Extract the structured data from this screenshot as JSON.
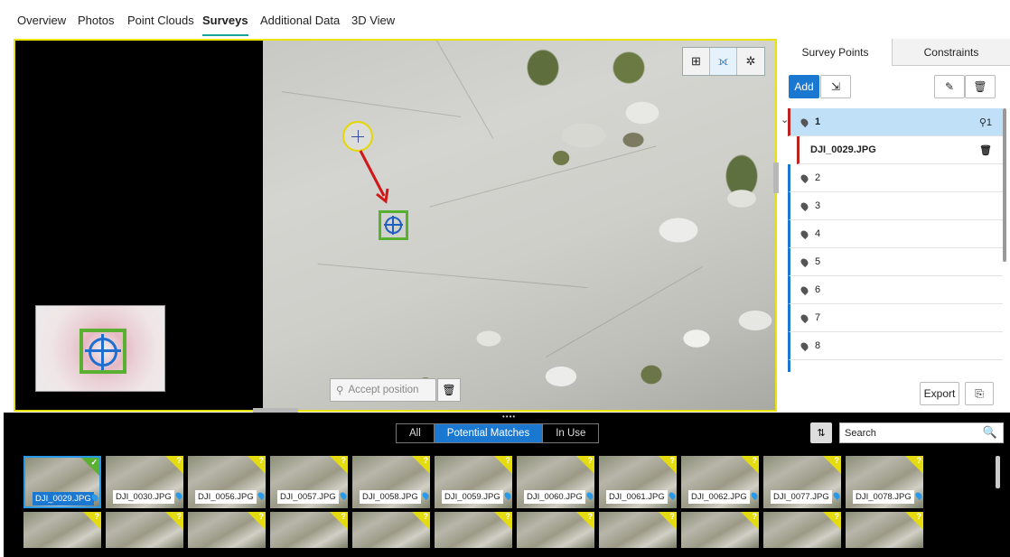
{
  "nav": {
    "tabs": [
      "Overview",
      "Photos",
      "Point Clouds",
      "Surveys",
      "Additional Data",
      "3D View"
    ],
    "active": "Surveys"
  },
  "viewer": {
    "accept_label": "Accept position",
    "tool_icons": [
      "fit-view-icon",
      "measure-icon",
      "settings-icon"
    ]
  },
  "panel": {
    "tabs": [
      "Survey Points",
      "Constraints"
    ],
    "add_label": "Add",
    "export_label": "Export",
    "selected_point": "1",
    "selected_point_count": "1",
    "selected_image": "DJI_0029.JPG",
    "points": [
      "2",
      "3",
      "4",
      "5",
      "6",
      "7",
      "8"
    ]
  },
  "bottom": {
    "filters": [
      "All",
      "Potential Matches",
      "In Use"
    ],
    "active_filter": "Potential Matches",
    "search_value": "Search",
    "thumbnails": [
      "DJI_0029.JPG",
      "DJI_0030.JPG",
      "DJI_0056.JPG",
      "DJI_0057.JPG",
      "DJI_0058.JPG",
      "DJI_0059.JPG",
      "DJI_0060.JPG",
      "DJI_0061.JPG",
      "DJI_0062.JPG",
      "DJI_0077.JPG",
      "DJI_0078.JPG"
    ]
  },
  "colors": {
    "accent": "#1a78d0",
    "marker_border": "#e9e400",
    "match": "#58b030"
  }
}
